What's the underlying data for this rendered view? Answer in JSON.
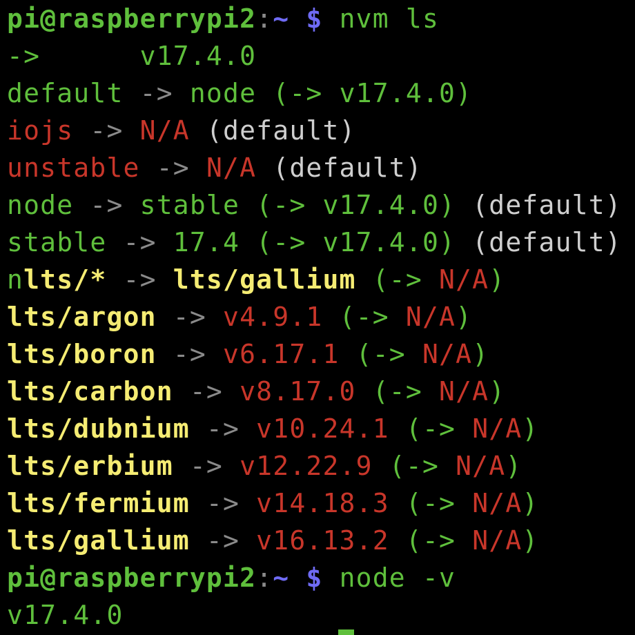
{
  "colors": {
    "green": "#5fbf3c",
    "red": "#c8362a",
    "white": "#cfcfcf",
    "gray": "#8a8a8a",
    "yellow": "#f5ec73",
    "blue": "#6f6bf4",
    "background": "#000000"
  },
  "lines": [
    [
      {
        "t": "pi@raspberrypi2",
        "c": "green",
        "b": true
      },
      {
        "t": ":",
        "c": "gray"
      },
      {
        "t": "~",
        "c": "blue",
        "b": true
      },
      {
        "t": " $ ",
        "c": "blue",
        "b": true
      },
      {
        "t": "nvm ls",
        "c": "green"
      }
    ],
    [
      {
        "t": "->",
        "c": "green"
      },
      {
        "t": "      v17.4.0",
        "c": "green"
      }
    ],
    [
      {
        "t": "default",
        "c": "green"
      },
      {
        "t": " -> ",
        "c": "gray"
      },
      {
        "t": "node",
        "c": "green"
      },
      {
        "t": " (-> ",
        "c": "green"
      },
      {
        "t": "v17.4.0",
        "c": "green"
      },
      {
        "t": ")",
        "c": "green"
      }
    ],
    [
      {
        "t": "iojs",
        "c": "red"
      },
      {
        "t": " -> ",
        "c": "gray"
      },
      {
        "t": "N/A",
        "c": "red"
      },
      {
        "t": " (default)",
        "c": "white"
      }
    ],
    [
      {
        "t": "unstable",
        "c": "red"
      },
      {
        "t": " -> ",
        "c": "gray"
      },
      {
        "t": "N/A",
        "c": "red"
      },
      {
        "t": " (default)",
        "c": "white"
      }
    ],
    [
      {
        "t": "node",
        "c": "green"
      },
      {
        "t": " -> ",
        "c": "gray"
      },
      {
        "t": "stable",
        "c": "green"
      },
      {
        "t": " (-> ",
        "c": "green"
      },
      {
        "t": "v17.4.0",
        "c": "green"
      },
      {
        "t": ")",
        "c": "green"
      },
      {
        "t": " (default)",
        "c": "white"
      }
    ],
    [
      {
        "t": "stable",
        "c": "green"
      },
      {
        "t": " -> ",
        "c": "gray"
      },
      {
        "t": "17.4",
        "c": "green"
      },
      {
        "t": " (-> ",
        "c": "green"
      },
      {
        "t": "v17.4.0",
        "c": "green"
      },
      {
        "t": ")",
        "c": "green"
      },
      {
        "t": " (default)",
        "c": "white"
      }
    ],
    [
      {
        "t": "n",
        "c": "green"
      },
      {
        "t": "lts/*",
        "c": "yellow"
      },
      {
        "t": " -> ",
        "c": "gray"
      },
      {
        "t": "lts/gallium",
        "c": "yellow"
      },
      {
        "t": " (-> ",
        "c": "green"
      },
      {
        "t": "N/A",
        "c": "red"
      },
      {
        "t": ")",
        "c": "green"
      }
    ],
    [
      {
        "t": "lts/argon",
        "c": "yellow"
      },
      {
        "t": " -> ",
        "c": "gray"
      },
      {
        "t": "v4.9.1",
        "c": "red"
      },
      {
        "t": " (-> ",
        "c": "green"
      },
      {
        "t": "N/A",
        "c": "red"
      },
      {
        "t": ")",
        "c": "green"
      }
    ],
    [
      {
        "t": "lts/boron",
        "c": "yellow"
      },
      {
        "t": " -> ",
        "c": "gray"
      },
      {
        "t": "v6.17.1",
        "c": "red"
      },
      {
        "t": " (-> ",
        "c": "green"
      },
      {
        "t": "N/A",
        "c": "red"
      },
      {
        "t": ")",
        "c": "green"
      }
    ],
    [
      {
        "t": "lts/carbon",
        "c": "yellow"
      },
      {
        "t": " -> ",
        "c": "gray"
      },
      {
        "t": "v8.17.0",
        "c": "red"
      },
      {
        "t": " (-> ",
        "c": "green"
      },
      {
        "t": "N/A",
        "c": "red"
      },
      {
        "t": ")",
        "c": "green"
      }
    ],
    [
      {
        "t": "lts/dubnium",
        "c": "yellow"
      },
      {
        "t": " -> ",
        "c": "gray"
      },
      {
        "t": "v10.24.1",
        "c": "red"
      },
      {
        "t": " (-> ",
        "c": "green"
      },
      {
        "t": "N/A",
        "c": "red"
      },
      {
        "t": ")",
        "c": "green"
      }
    ],
    [
      {
        "t": "lts/erbium",
        "c": "yellow"
      },
      {
        "t": " -> ",
        "c": "gray"
      },
      {
        "t": "v12.22.9",
        "c": "red"
      },
      {
        "t": " (-> ",
        "c": "green"
      },
      {
        "t": "N/A",
        "c": "red"
      },
      {
        "t": ")",
        "c": "green"
      }
    ],
    [
      {
        "t": "lts/fermium",
        "c": "yellow"
      },
      {
        "t": " -> ",
        "c": "gray"
      },
      {
        "t": "v14.18.3",
        "c": "red"
      },
      {
        "t": " (-> ",
        "c": "green"
      },
      {
        "t": "N/A",
        "c": "red"
      },
      {
        "t": ")",
        "c": "green"
      }
    ],
    [
      {
        "t": "lts/gallium",
        "c": "yellow"
      },
      {
        "t": " -> ",
        "c": "gray"
      },
      {
        "t": "v16.13.2",
        "c": "red"
      },
      {
        "t": " (-> ",
        "c": "green"
      },
      {
        "t": "N/A",
        "c": "red"
      },
      {
        "t": ")",
        "c": "green"
      }
    ],
    [
      {
        "t": "pi@raspberrypi2",
        "c": "green",
        "b": true
      },
      {
        "t": ":",
        "c": "gray"
      },
      {
        "t": "~",
        "c": "blue",
        "b": true
      },
      {
        "t": " $ ",
        "c": "blue",
        "b": true
      },
      {
        "t": "node -v",
        "c": "green"
      }
    ],
    [
      {
        "t": "v17.4.0",
        "c": "green"
      }
    ]
  ]
}
